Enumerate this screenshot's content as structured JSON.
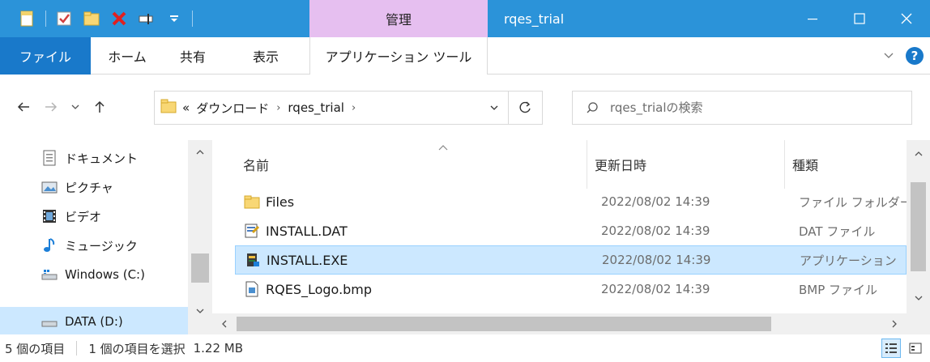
{
  "window": {
    "title": "rqes_trial",
    "context_group": "管理",
    "accent": "#2b93d9",
    "context_color": "#e6bff0"
  },
  "quick_access": {
    "icons": [
      "properties-icon",
      "checkmark-icon",
      "new-folder-icon",
      "delete-icon",
      "rename-icon",
      "customize-qat-icon"
    ]
  },
  "ribbon": {
    "tabs": [
      {
        "label": "ファイル",
        "active": true
      },
      {
        "label": "ホーム"
      },
      {
        "label": "共有"
      },
      {
        "label": "表示"
      },
      {
        "label": "アプリケーション ツール"
      }
    ]
  },
  "address": {
    "overflow": "«",
    "crumbs": [
      "ダウンロード",
      "rqes_trial"
    ],
    "separator": "›"
  },
  "search": {
    "placeholder": "rqes_trialの検索"
  },
  "navpane": {
    "items": [
      {
        "label": "ドキュメント",
        "icon": "documents-icon"
      },
      {
        "label": "ピクチャ",
        "icon": "pictures-icon"
      },
      {
        "label": "ビデオ",
        "icon": "videos-icon"
      },
      {
        "label": "ミュージック",
        "icon": "music-icon"
      },
      {
        "label": "Windows (C:)",
        "icon": "drive-icon"
      },
      {
        "label": "DATA (D:)",
        "icon": "drive-icon",
        "selected": true
      }
    ]
  },
  "filelist": {
    "columns": {
      "name": "名前",
      "date": "更新日時",
      "type": "種類"
    },
    "rows": [
      {
        "name": "Files",
        "date": "2022/08/02 14:39",
        "type": "ファイル フォルダー",
        "icon": "folder-icon"
      },
      {
        "name": "INSTALL.DAT",
        "date": "2022/08/02 14:39",
        "type": "DAT ファイル",
        "icon": "dat-file-icon"
      },
      {
        "name": "INSTALL.EXE",
        "date": "2022/08/02 14:39",
        "type": "アプリケーション",
        "icon": "exe-file-icon",
        "selected": true
      },
      {
        "name": "RQES_Logo.bmp",
        "date": "2022/08/02 14:39",
        "type": "BMP ファイル",
        "icon": "bmp-file-icon"
      }
    ]
  },
  "status": {
    "count": "5 個の項目",
    "selection": "1 個の項目を選択",
    "size": "1.22 MB"
  }
}
